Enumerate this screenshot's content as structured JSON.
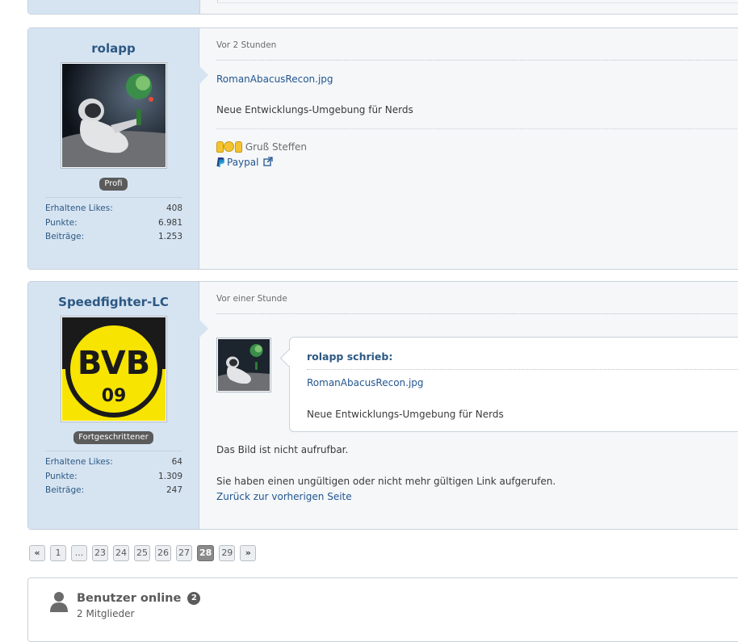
{
  "posts": [
    {
      "author": "rolapp",
      "rank": "Profi",
      "stats": [
        {
          "label": "Erhaltene Likes:",
          "value": "408"
        },
        {
          "label": "Punkte:",
          "value": "6.981"
        },
        {
          "label": "Beiträge:",
          "value": "1.253"
        }
      ],
      "time": "Vor 2 Stunden",
      "attachment_link": "RomanAbacusRecon.jpg",
      "text": "Neue Entwicklungs-Umgebung für Nerds",
      "signature_text": "Gruß Steffen",
      "paypal_label": "Paypal"
    },
    {
      "author": "Speedfighter-LC",
      "rank": "Fortgeschrittener",
      "stats": [
        {
          "label": "Erhaltene Likes:",
          "value": "64"
        },
        {
          "label": "Punkte:",
          "value": "1.309"
        },
        {
          "label": "Beiträge:",
          "value": "247"
        }
      ],
      "time": "Vor einer Stunde",
      "quote": {
        "author_label": "rolapp schrieb:",
        "link": "RomanAbacusRecon.jpg",
        "text": "Neue Entwicklungs-Umgebung für Nerds"
      },
      "text_1": "Das Bild ist nicht aufrufbar.",
      "text_2": "Sie haben einen ungültigen oder nicht mehr gültigen Link aufgerufen.",
      "back_link": "Zurück zur vorherigen Seite"
    }
  ],
  "pagination": {
    "prev": "«",
    "first": "1",
    "ellipsis": "...",
    "pages": [
      "23",
      "24",
      "25",
      "26",
      "27",
      "28",
      "29"
    ],
    "active": "28",
    "next": "»"
  },
  "online": {
    "title": "Benutzer online",
    "count": "2",
    "subtitle": "2 Mitglieder"
  },
  "icons": {
    "paypal": "paypal-icon",
    "external": "external-link-icon",
    "user": "user-icon"
  },
  "colors": {
    "sidebar_bg": "#d6e4f2",
    "link": "#23568f",
    "username": "#2c5882",
    "badge": "#5b5b5b"
  }
}
